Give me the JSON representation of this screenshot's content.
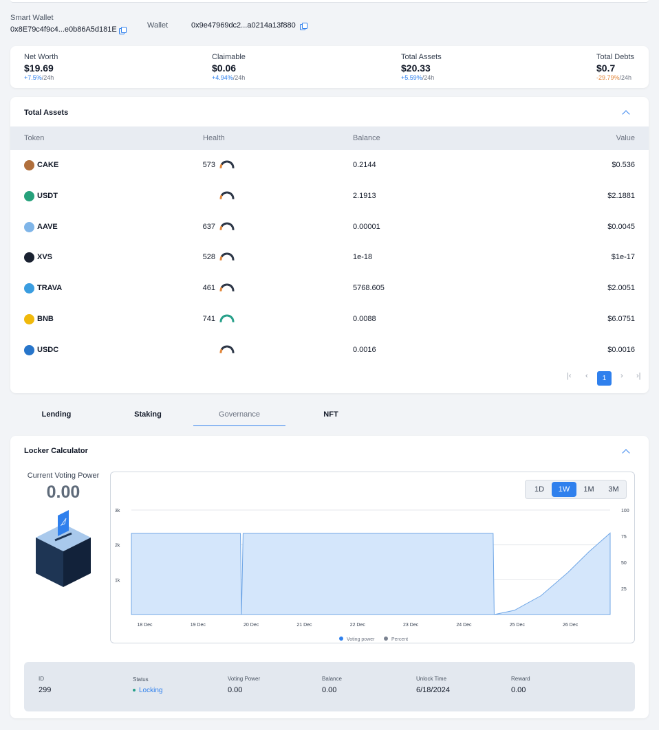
{
  "wallets": {
    "smart_label": "Smart Wallet",
    "smart_address": "0x8E79c4f9c4...e0b86A5d181E",
    "wallet_label": "Wallet",
    "wallet_address": "0x9e47969dc2...a0214a13f880"
  },
  "stats": [
    {
      "label": "Net Worth",
      "value": "$19.69",
      "change": "+7.5%",
      "period": "/24h",
      "trend": "up"
    },
    {
      "label": "Claimable",
      "value": "$0.06",
      "change": "+4.94%",
      "period": "/24h",
      "trend": "up"
    },
    {
      "label": "Total Assets",
      "value": "$20.33",
      "change": "+5.59%",
      "period": "/24h",
      "trend": "up"
    },
    {
      "label": "Total Debts",
      "value": "$0.7",
      "change": "-29.79%",
      "period": "/24h",
      "trend": "down"
    }
  ],
  "assets": {
    "title": "Total Assets",
    "columns": [
      "Token",
      "Health",
      "Balance",
      "Value"
    ],
    "rows": [
      {
        "token": "CAKE",
        "health": "573",
        "health_level": 0.35,
        "balance": "0.2144",
        "value": "$0.536",
        "icon_color": "#b06f3c",
        "icon": "cake-icon"
      },
      {
        "token": "USDT",
        "health": "",
        "health_level": 0.25,
        "balance": "2.1913",
        "value": "$2.1881",
        "icon_color": "#26a17b",
        "icon": "usdt-icon"
      },
      {
        "token": "AAVE",
        "health": "637",
        "health_level": 0.35,
        "balance": "0.00001",
        "value": "$0.0045",
        "icon_color": "#7fb5e8",
        "icon": "aave-icon"
      },
      {
        "token": "XVS",
        "health": "528",
        "health_level": 0.25,
        "balance": "1e-18",
        "value": "$1e-17",
        "icon_color": "#1a2231",
        "icon": "xvs-icon"
      },
      {
        "token": "TRAVA",
        "health": "461",
        "health_level": 0.1,
        "balance": "5768.605",
        "value": "$2.0051",
        "icon_color": "#3a9de0",
        "icon": "trava-icon"
      },
      {
        "token": "BNB",
        "health": "741",
        "health_level": 1.0,
        "balance": "0.0088",
        "value": "$6.0751",
        "icon_color": "#f0b90b",
        "icon": "bnb-icon"
      },
      {
        "token": "USDC",
        "health": "",
        "health_level": 0.25,
        "balance": "0.0016",
        "value": "$0.0016",
        "icon_color": "#2775ca",
        "icon": "usdc-icon"
      }
    ],
    "pagination": {
      "current": "1"
    }
  },
  "tabs": [
    "Lending",
    "Staking",
    "Governance",
    "NFT"
  ],
  "active_tab": "Governance",
  "locker": {
    "title": "Locker Calculator",
    "voting_power_label": "Current Voting Power",
    "voting_power_value": "0.00",
    "timeframes": [
      "1D",
      "1W",
      "1M",
      "3M"
    ],
    "active_timeframe": "1W",
    "info": {
      "id_label": "ID",
      "id": "299",
      "status_label": "Status",
      "status": "Locking",
      "vp_label": "Voting Power",
      "vp": "0.00",
      "balance_label": "Balance",
      "balance": "0.00",
      "unlock_label": "Unlock Time",
      "unlock": "6/18/2024",
      "reward_label": "Reward",
      "reward": "0.00"
    }
  },
  "colors": {
    "accent": "#2f80ed",
    "area_fill": "#d4e6fb",
    "status_green": "#28a08a"
  },
  "chart_data": {
    "type": "area",
    "x": [
      "18 Dec",
      "19 Dec",
      "20 Dec",
      "21 Dec",
      "22 Dec",
      "23 Dec",
      "24 Dec",
      "25 Dec",
      "26 Dec"
    ],
    "y_left_ticks": [
      "3k",
      "2k",
      "1k"
    ],
    "y_right_ticks": [
      "100",
      "75",
      "50",
      "25"
    ],
    "ylim_left": [
      0,
      3000
    ],
    "ylim_right": [
      0,
      100
    ],
    "legend": [
      "Voting power",
      "Percent"
    ],
    "legend_placement": "bottom",
    "series": [
      {
        "name": "Voting power",
        "axis": "left",
        "points": [
          [
            17.8,
            2330
          ],
          [
            19.85,
            2330
          ],
          [
            19.87,
            0
          ],
          [
            19.9,
            2330
          ],
          [
            24.6,
            2330
          ],
          [
            24.62,
            0
          ]
        ]
      },
      {
        "name": "Percent",
        "axis": "right",
        "points": [
          [
            24.62,
            0
          ],
          [
            25.0,
            4
          ],
          [
            25.5,
            18
          ],
          [
            26.0,
            40
          ],
          [
            26.4,
            60
          ],
          [
            26.8,
            78
          ]
        ]
      }
    ]
  }
}
